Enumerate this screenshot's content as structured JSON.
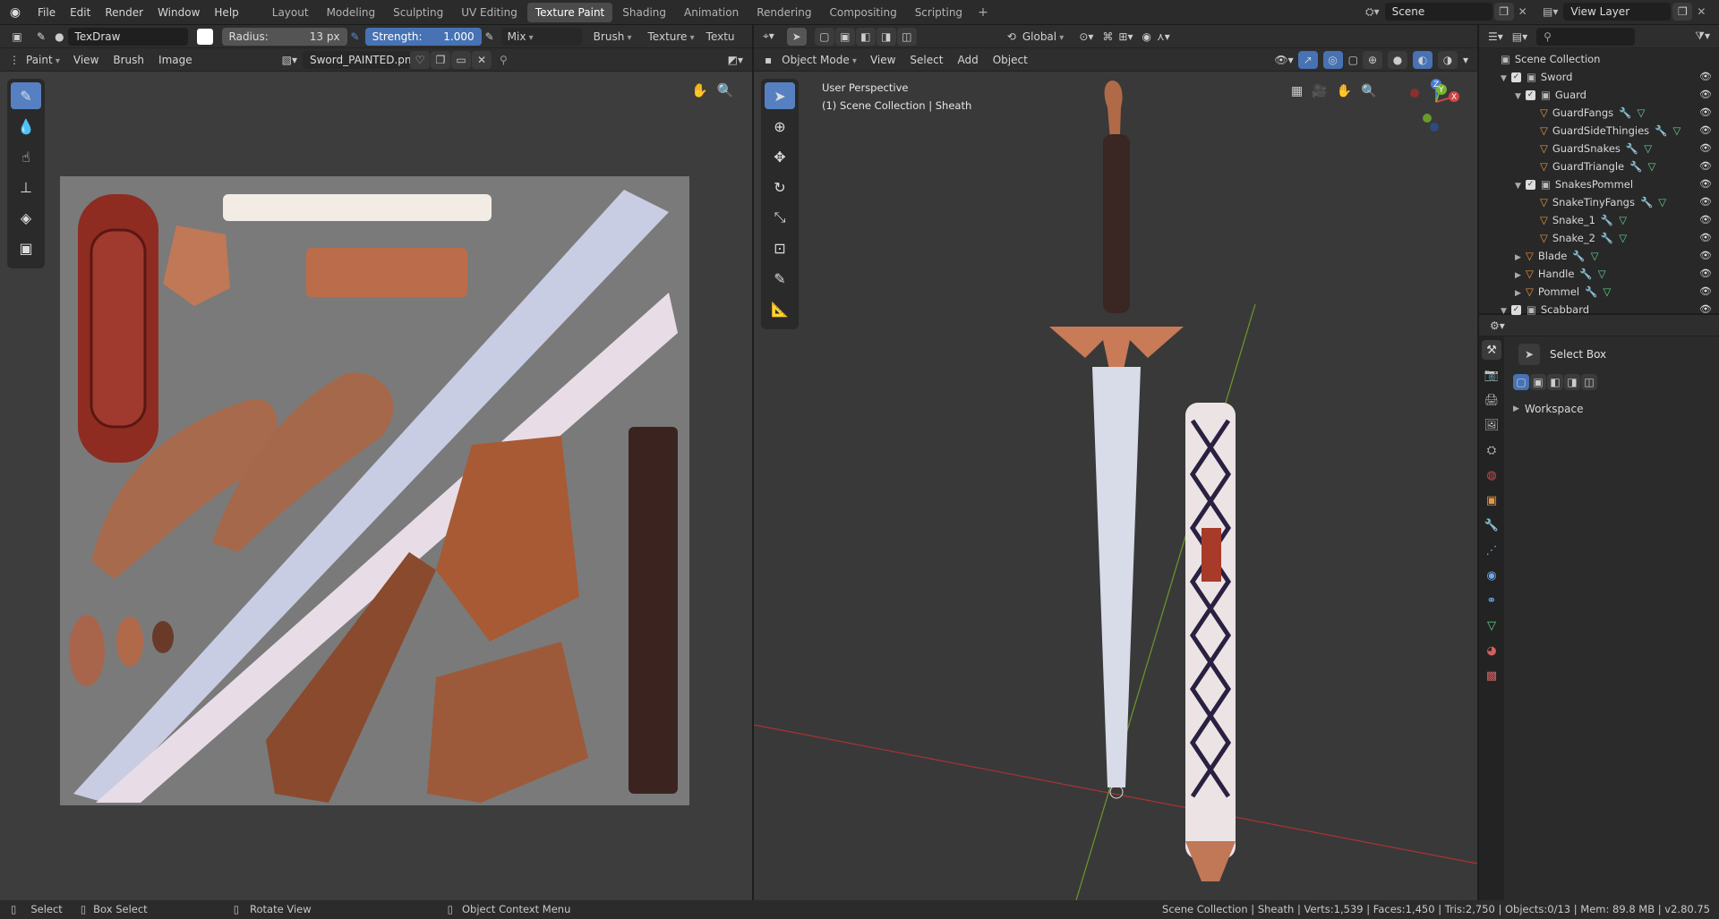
{
  "menu": {
    "file": "File",
    "edit": "Edit",
    "render": "Render",
    "window": "Window",
    "help": "Help"
  },
  "workspaces": [
    "Layout",
    "Modeling",
    "Sculpting",
    "UV Editing",
    "Texture Paint",
    "Shading",
    "Animation",
    "Rendering",
    "Compositing",
    "Scripting"
  ],
  "active_workspace": "Texture Paint",
  "scene": {
    "name": "Scene",
    "view_layer": "View Layer"
  },
  "paint_header": {
    "brush_name": "TexDraw",
    "radius_label": "Radius:",
    "radius_value": "13 px",
    "strength_label": "Strength:",
    "strength_value": "1.000",
    "strength_fraction": 1.0,
    "blend": "Mix",
    "brush_menu": "Brush",
    "texture_menu": "Texture",
    "texture_cut": "Textu"
  },
  "image_editor": {
    "mode": "Paint",
    "view": "View",
    "brush": "Brush",
    "image": "Image",
    "image_name": "Sword_PAINTED.png"
  },
  "viewport": {
    "mode": "Object Mode",
    "view": "View",
    "select": "Select",
    "add": "Add",
    "object": "Object",
    "orientation": "Global",
    "perspective": "User Perspective",
    "collection_info": "(1) Scene Collection | Sheath",
    "gizmo": {
      "z": "Z",
      "y": "Y",
      "x": "X"
    }
  },
  "outliner": {
    "root": "Scene Collection",
    "items": [
      {
        "label": "Sword",
        "kind": "collection",
        "depth": 1
      },
      {
        "label": "Guard",
        "kind": "collection",
        "depth": 2
      },
      {
        "label": "GuardFangs",
        "kind": "object",
        "depth": 3
      },
      {
        "label": "GuardSideThingies",
        "kind": "object",
        "depth": 3
      },
      {
        "label": "GuardSnakes",
        "kind": "object",
        "depth": 3
      },
      {
        "label": "GuardTriangle",
        "kind": "object",
        "depth": 3
      },
      {
        "label": "SnakesPommel",
        "kind": "collection",
        "depth": 2
      },
      {
        "label": "SnakeTinyFangs",
        "kind": "object",
        "depth": 3
      },
      {
        "label": "Snake_1",
        "kind": "object",
        "depth": 3
      },
      {
        "label": "Snake_2",
        "kind": "object",
        "depth": 3
      },
      {
        "label": "Blade",
        "kind": "object",
        "depth": 2
      },
      {
        "label": "Handle",
        "kind": "object",
        "depth": 2
      },
      {
        "label": "Pommel",
        "kind": "object",
        "depth": 2
      },
      {
        "label": "Scabbard",
        "kind": "collection",
        "depth": 1
      }
    ]
  },
  "properties": {
    "tool": "Select Box",
    "panel": "Workspace"
  },
  "status": {
    "select": "Select",
    "box_select": "Box Select",
    "rotate": "Rotate View",
    "context": "Object Context Menu",
    "stats": "Scene Collection | Sheath | Verts:1,539 | Faces:1,450 | Tris:2,750 | Objects:0/13 | Mem: 89.8 MB | v2.80.75"
  },
  "colors": {
    "accent": "#5680c2",
    "active_tab": "#4b4b4b",
    "bg": "#1d1d1d",
    "panel": "#303030"
  }
}
